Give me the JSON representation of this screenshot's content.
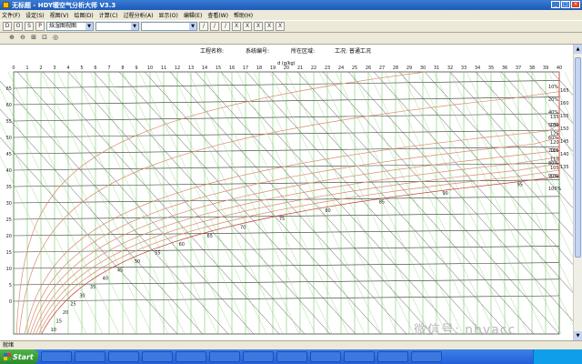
{
  "window": {
    "title": "无标题 - HDY暖空气分析大师 V3.3",
    "buttons": [
      "_",
      "□",
      "×"
    ]
  },
  "menu": [
    "文件(F)",
    "设定(S)",
    "视图(V)",
    "绘图(D)",
    "计算(C)",
    "过程分析(A)",
    "显示(O)",
    "编辑(E)",
    "查看(W)",
    "帮助(H)"
  ],
  "toolbar": {
    "view_select": "焓湿图视图",
    "select2": "",
    "select3": "",
    "buttons": [
      "D",
      "O",
      "S",
      "P"
    ],
    "draw_buttons": [
      "/",
      "/",
      "/",
      "X",
      "X",
      "X",
      "X",
      "X"
    ]
  },
  "zoom_buttons": [
    "⊕",
    "⊖",
    "⊞",
    "⊡",
    "◎"
  ],
  "chart_header": {
    "project": "工程名称:",
    "system": "系统编号:",
    "region": "所在区域:",
    "condition": "工况: 普通工况",
    "x_unit": "d (g/kg)"
  },
  "chart_data": {
    "type": "line",
    "title": "",
    "xlabel": "d (g/kg)",
    "xlim": [
      0,
      40
    ],
    "ylim": [
      -10,
      70
    ],
    "x_ticks": [
      0,
      1,
      2,
      3,
      4,
      5,
      6,
      7,
      8,
      9,
      10,
      11,
      12,
      13,
      14,
      15,
      16,
      17,
      18,
      19,
      20,
      21,
      22,
      23,
      24,
      25,
      26,
      27,
      28,
      29,
      30,
      31,
      32,
      33,
      34,
      35,
      36,
      37,
      38,
      39,
      40
    ],
    "y_ticks": [
      0,
      5,
      10,
      15,
      20,
      25,
      30,
      35,
      40,
      45,
      50,
      55,
      60,
      65
    ],
    "rh_labels": [
      "10%",
      "20%",
      "40%",
      "50%",
      "60%",
      "70%",
      "80%",
      "90%",
      "100%"
    ],
    "enthalpy_labels": [
      "10",
      "15",
      "20",
      "25",
      "30",
      "35",
      "40",
      "45",
      "50",
      "55",
      "60",
      "65",
      "70",
      "75",
      "80",
      "85",
      "90",
      "95",
      "100",
      "105",
      "110",
      "115",
      "120",
      "125",
      "130",
      "135"
    ],
    "right_labels": [
      "165",
      "160",
      "155",
      "150",
      "145",
      "140",
      "135"
    ]
  },
  "status": {
    "text": "就绪"
  },
  "taskbar": {
    "start_label": "Start",
    "items": [
      "",
      "",
      "",
      "",
      "",
      "",
      "",
      "",
      "",
      "",
      "",
      "",
      "",
      "",
      ""
    ]
  },
  "watermark": "微信号: nhvacc"
}
